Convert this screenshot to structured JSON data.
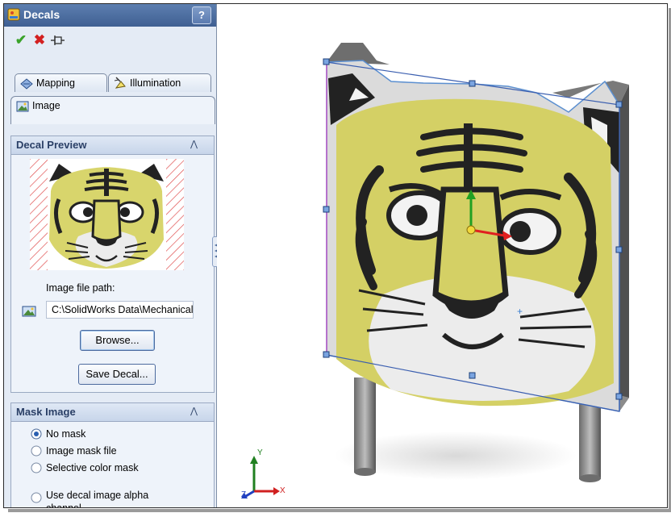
{
  "panel": {
    "title": "Decals",
    "help_label": "?",
    "ok_symbol": "✔",
    "cancel_symbol": "✖"
  },
  "tabs": [
    {
      "label": "Mapping"
    },
    {
      "label": "Illumination"
    },
    {
      "label": "Image"
    }
  ],
  "decal_preview": {
    "header": "Decal Preview",
    "collapse_symbol": "«",
    "path_label": "Image file path:",
    "path_value": "C:\\SolidWorks Data\\Mechanical",
    "browse_label": "Browse...",
    "save_label": "Save Decal..."
  },
  "mask_image": {
    "header": "Mask Image",
    "collapse_symbol": "«",
    "options": [
      {
        "label": "No mask",
        "selected": true
      },
      {
        "label": "Image mask file",
        "selected": false
      },
      {
        "label": "Selective color mask",
        "selected": false
      },
      {
        "label": "Use decal image alpha channel",
        "selected": false
      }
    ]
  },
  "triad": {
    "x": "X",
    "y": "Y",
    "z": "Z"
  },
  "colors": {
    "title_bar": "#4a6ca0",
    "panel_bg": "#e4ebf5",
    "tiger_yellow": "#d4d065",
    "tiger_black": "#1a1a1a",
    "sign_gray": "#d9d9d9",
    "handle_blue": "#3b6fb6",
    "axis_red": "#e02020",
    "axis_green": "#20a020",
    "axis_blue": "#2040c0"
  }
}
